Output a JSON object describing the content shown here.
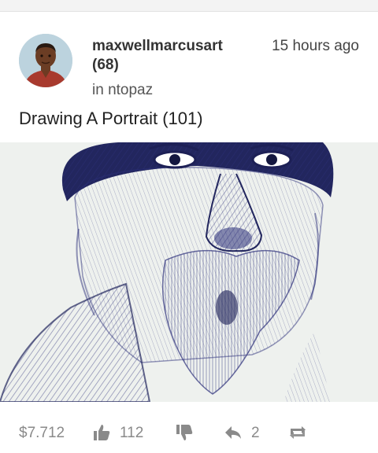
{
  "post": {
    "author": "maxwellmarcusart",
    "reputation": "(68)",
    "community": "in ntopaz",
    "timestamp": "15 hours ago",
    "title": "Drawing A Portrait  (101)"
  },
  "footer": {
    "payout": "$7.712",
    "votes": "112",
    "replies": "2"
  },
  "icons": {
    "upvote": "thumbs-up-icon",
    "downvote": "thumbs-down-icon",
    "reply": "reply-icon",
    "resteem": "resteem-icon"
  },
  "colors": {
    "ink": "#2c2f7a",
    "muted": "#8a8a8a"
  }
}
